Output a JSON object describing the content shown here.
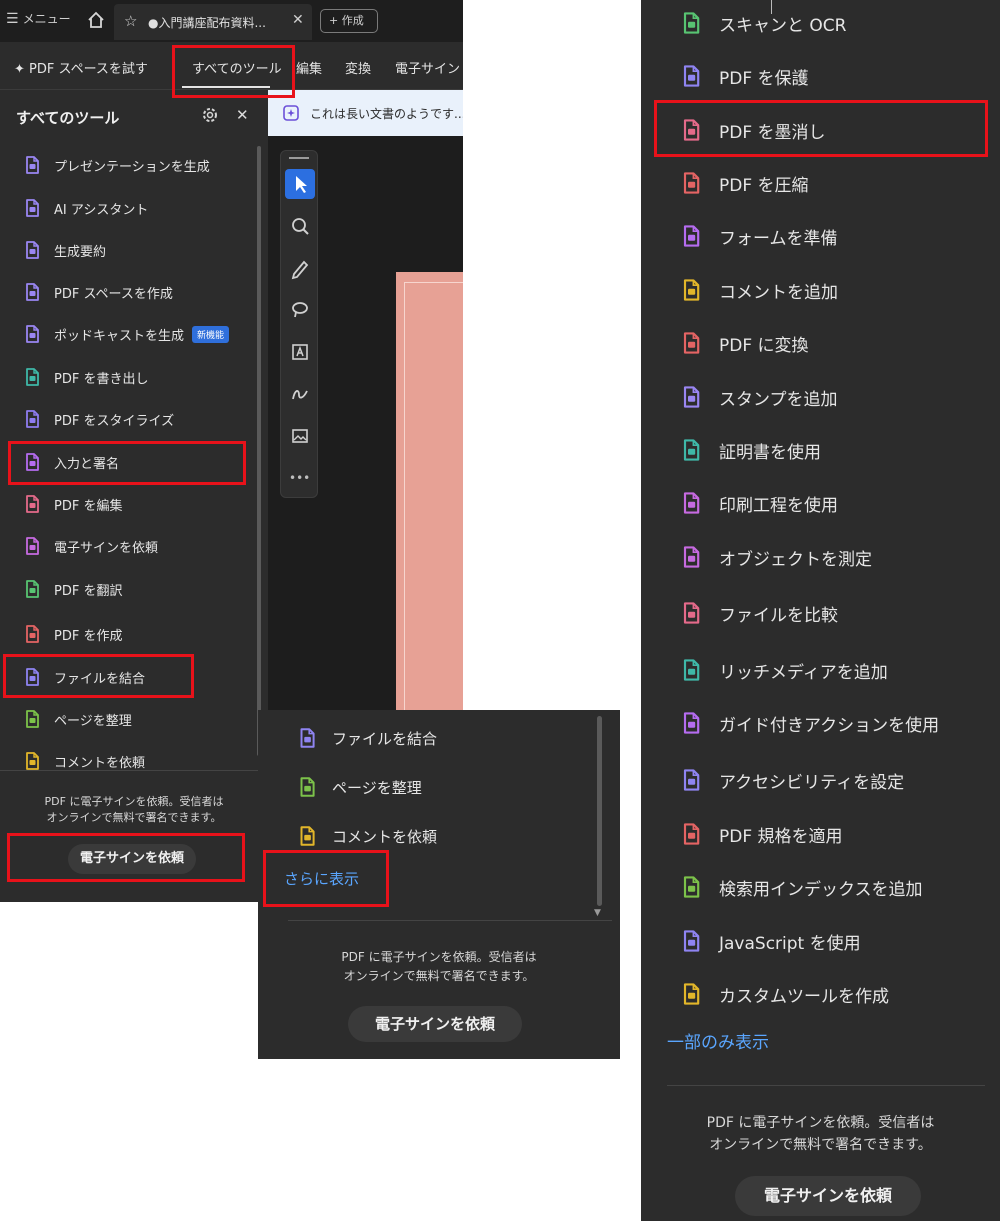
{
  "panel_a": {
    "tabbar": {
      "menu_label": "メニュー",
      "document_tab": "●入門講座配布資料...",
      "new_tab": "+ 作成"
    },
    "toolbar": {
      "pdf_space_try": "PDF スペースを試す",
      "all_tools": "すべてのツール",
      "edit": "編集",
      "convert": "変換",
      "esign": "電子サイン"
    },
    "notice": "これは長い文書のようです...",
    "sidepanel": {
      "title": "すべてのツール",
      "tools": [
        {
          "label": "プレゼンテーションを生成",
          "icon": "presentation-icon",
          "color": "#9a86f2"
        },
        {
          "label": "AI アシスタント",
          "icon": "ai-assistant-icon",
          "color": "#9a86f2"
        },
        {
          "label": "生成要約",
          "icon": "summary-icon",
          "color": "#9a86f2"
        },
        {
          "label": "PDF スペースを作成",
          "icon": "pdf-space-icon",
          "color": "#9a86f2"
        },
        {
          "label": "ポッドキャストを生成",
          "icon": "podcast-icon",
          "color": "#9a86f2",
          "badge": "新機能"
        },
        {
          "label": "PDF を書き出し",
          "icon": "export-pdf-icon",
          "color": "#3fb8a8"
        },
        {
          "label": "PDF をスタイライズ",
          "icon": "stylize-icon",
          "color": "#8f7cf0"
        },
        {
          "label": "入力と署名",
          "icon": "fill-sign-icon",
          "color": "#b56cf0"
        },
        {
          "label": "PDF を編集",
          "icon": "edit-pdf-icon",
          "color": "#e46a8a"
        },
        {
          "label": "電子サインを依頼",
          "icon": "request-esign-icon",
          "color": "#c66ae0"
        },
        {
          "label": "PDF を翻訳",
          "icon": "translate-icon",
          "color": "#58c472"
        },
        {
          "label": "PDF を作成",
          "icon": "create-pdf-icon",
          "color": "#e46464"
        },
        {
          "label": "ファイルを結合",
          "icon": "combine-files-icon",
          "color": "#8f84f2"
        },
        {
          "label": "ページを整理",
          "icon": "organize-pages-icon",
          "color": "#7cc24a"
        },
        {
          "label": "コメントを依頼",
          "icon": "request-comments-icon",
          "color": "#e2b62a"
        }
      ],
      "promo_line1": "PDF に電子サインを依頼。受信者は",
      "promo_line2": "オンラインで無料で署名できます。",
      "esign_button": "電子サインを依頼"
    }
  },
  "panel_b": {
    "tools": [
      {
        "label": "ファイルを結合",
        "icon": "combine-files-icon",
        "color": "#8f84f2"
      },
      {
        "label": "ページを整理",
        "icon": "organize-pages-icon",
        "color": "#7cc24a"
      },
      {
        "label": "コメントを依頼",
        "icon": "request-comments-icon",
        "color": "#e2b62a"
      }
    ],
    "show_more": "さらに表示",
    "promo_line1": "PDF に電子サインを依頼。受信者は",
    "promo_line2": "オンラインで無料で署名できます。",
    "esign_button": "電子サインを依頼"
  },
  "panel_c": {
    "tools": [
      {
        "label": "スキャンと OCR",
        "icon": "scan-ocr-icon",
        "color": "#58c472"
      },
      {
        "label": "PDF を保護",
        "icon": "protect-pdf-icon",
        "color": "#8f84f2"
      },
      {
        "label": "PDF を墨消し",
        "icon": "redact-icon",
        "color": "#e46a8a"
      },
      {
        "label": "PDF を圧縮",
        "icon": "compress-icon",
        "color": "#e46464"
      },
      {
        "label": "フォームを準備",
        "icon": "prepare-form-icon",
        "color": "#b56cf0"
      },
      {
        "label": "コメントを追加",
        "icon": "add-comment-icon",
        "color": "#e2b62a"
      },
      {
        "label": "PDF に変換",
        "icon": "convert-pdf-icon",
        "color": "#e46464"
      },
      {
        "label": "スタンプを追加",
        "icon": "stamp-icon",
        "color": "#9a86f2"
      },
      {
        "label": "証明書を使用",
        "icon": "certificate-icon",
        "color": "#3fb8a8"
      },
      {
        "label": "印刷工程を使用",
        "icon": "print-production-icon",
        "color": "#c66ae0"
      },
      {
        "label": "オブジェクトを測定",
        "icon": "measure-icon",
        "color": "#c66ae0"
      },
      {
        "label": "ファイルを比較",
        "icon": "compare-files-icon",
        "color": "#e46a8a"
      },
      {
        "label": "リッチメディアを追加",
        "icon": "rich-media-icon",
        "color": "#3fb8a8"
      },
      {
        "label": "ガイド付きアクションを使用",
        "icon": "guided-actions-icon",
        "color": "#b56cf0"
      },
      {
        "label": "アクセシビリティを設定",
        "icon": "accessibility-icon",
        "color": "#8f84f2"
      },
      {
        "label": "PDF 規格を適用",
        "icon": "pdf-standards-icon",
        "color": "#e46464"
      },
      {
        "label": "検索用インデックスを追加",
        "icon": "search-index-icon",
        "color": "#7cc24a"
      },
      {
        "label": "JavaScript を使用",
        "icon": "javascript-icon",
        "color": "#8f84f2"
      },
      {
        "label": "カスタムツールを作成",
        "icon": "custom-tool-icon",
        "color": "#e2b62a"
      }
    ],
    "show_less": "一部のみ表示",
    "promo_line1": "PDF に電子サインを依頼。受信者は",
    "promo_line2": "オンラインで無料で署名できます。",
    "esign_button": "電子サインを依頼"
  },
  "colors": {
    "highlight": "#e8121a",
    "panel_bg": "#2c2c2c",
    "link": "#5aa6ff",
    "active_tool": "#2c6fe0",
    "document": "#e7a195"
  }
}
